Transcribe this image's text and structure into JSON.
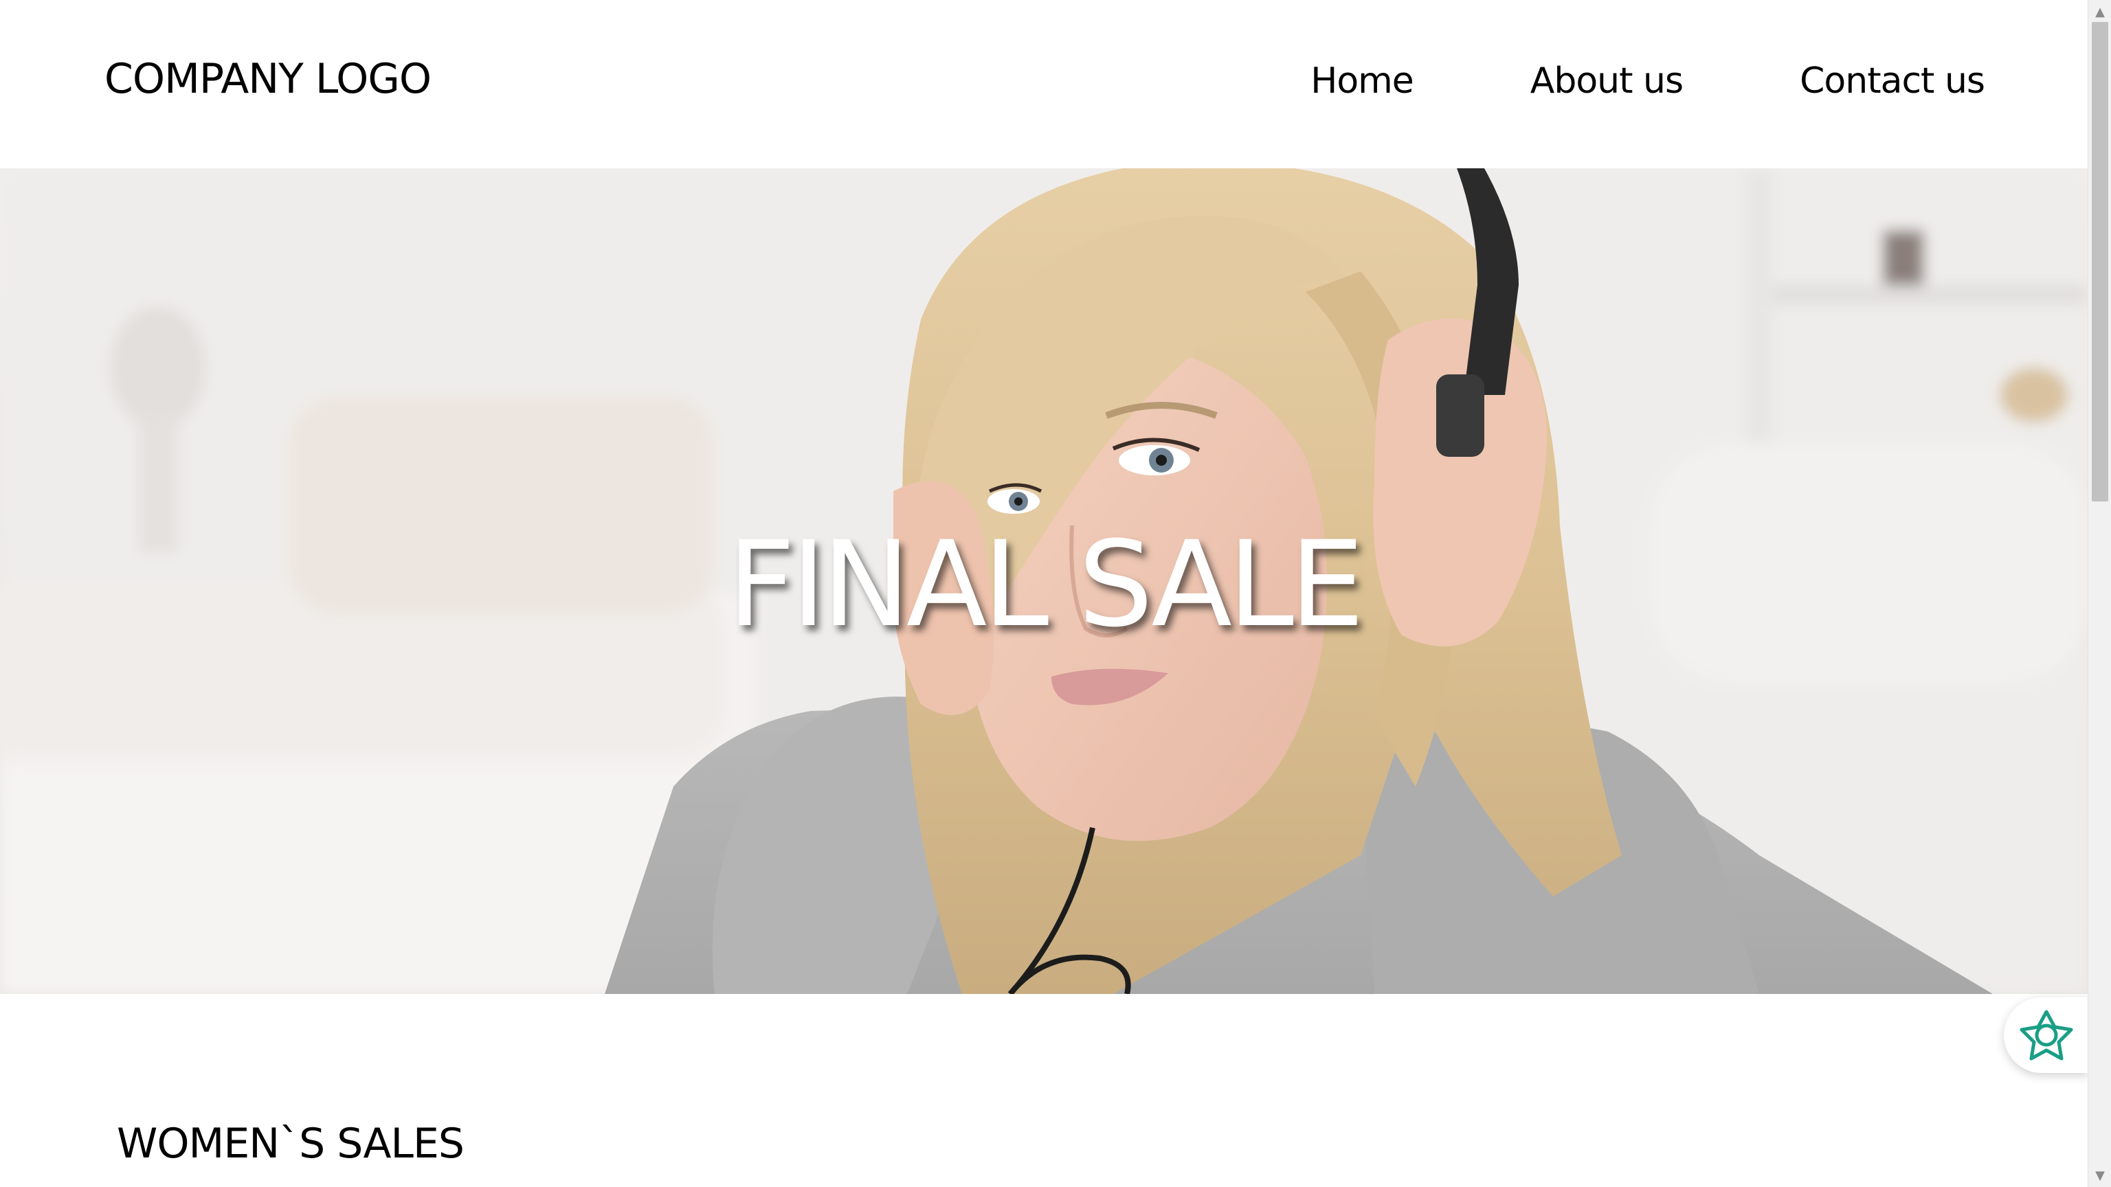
{
  "header": {
    "logo_text": "COMPANY LOGO",
    "nav": [
      {
        "label": "Home"
      },
      {
        "label": "About us"
      },
      {
        "label": "Contact us"
      }
    ]
  },
  "hero": {
    "title": "FINAL SALE",
    "image_alt": "woman with headphones"
  },
  "section": {
    "title": "WOMEN`S SALES"
  },
  "widget": {
    "icon": "assistant-knot-icon",
    "color": "#1a9e85"
  },
  "colors": {
    "text": "#000000",
    "hero_title": "#ffffff",
    "background": "#ffffff"
  }
}
